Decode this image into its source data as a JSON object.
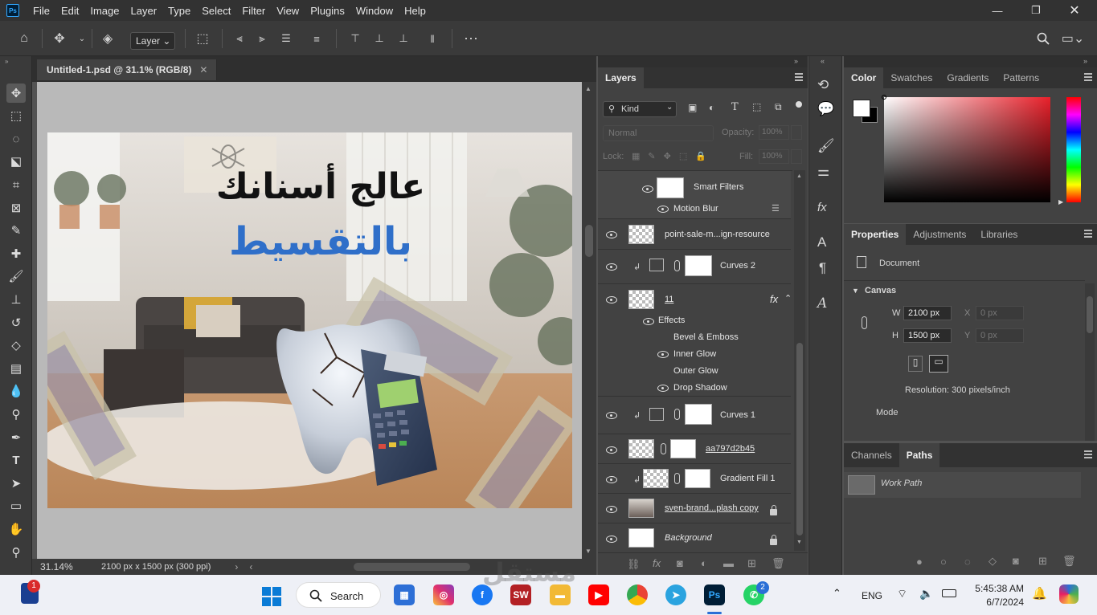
{
  "menu": [
    "File",
    "Edit",
    "Image",
    "Layer",
    "Type",
    "Select",
    "Filter",
    "View",
    "Plugins",
    "Window",
    "Help"
  ],
  "app_logo": "Ps",
  "options": {
    "auto_select_target": "Layer"
  },
  "document": {
    "tab_title": "Untitled-1.psd @ 31.1% (RGB/8)",
    "zoom": "31.14%",
    "dimensions": "2100 px x 1500 px (300 ppi)"
  },
  "artwork": {
    "headline_line1": "عالج أسنانك",
    "headline_line2": "بالتقسيط"
  },
  "layers_panel": {
    "tab": "Layers",
    "filter_kind": "Kind",
    "blend_mode": "Normal",
    "opacity_label": "Opacity:",
    "opacity": "100%",
    "lock_label": "Lock:",
    "fill_label": "Fill:",
    "fill": "100%",
    "smart_filters": "Smart Filters",
    "motion_blur": "Motion Blur",
    "layers": [
      {
        "name": "point-sale-m...ign-resource"
      },
      {
        "name": "Curves 2"
      },
      {
        "name": "11"
      },
      {
        "name": "Curves 1"
      },
      {
        "name": "aa797d2b45"
      },
      {
        "name": "Gradient Fill 1"
      },
      {
        "name": "sven-brand...plash copy"
      },
      {
        "name": "Background"
      }
    ],
    "effects_label": "Effects",
    "effects": [
      "Bevel & Emboss",
      "Inner Glow",
      "Outer Glow",
      "Drop Shadow"
    ]
  },
  "color_panel": {
    "tabs": [
      "Color",
      "Swatches",
      "Gradients",
      "Patterns"
    ]
  },
  "properties_panel": {
    "tabs": [
      "Properties",
      "Adjustments",
      "Libraries"
    ],
    "doc_label": "Document",
    "canvas_label": "Canvas",
    "w_label": "W",
    "w": "2100 px",
    "h_label": "H",
    "h": "1500 px",
    "x_label": "X",
    "x": "0 px",
    "y_label": "Y",
    "y": "0 px",
    "resolution": "Resolution: 300 pixels/inch",
    "mode_label": "Mode"
  },
  "paths_panel": {
    "tabs": [
      "Channels",
      "Paths"
    ],
    "work_path": "Work Path"
  },
  "taskbar": {
    "search": "Search",
    "lang": "ENG",
    "time": "5:45:38 AM",
    "date": "6/7/2024",
    "badge_left": "1",
    "badge_whatsapp": "2",
    "watermark": "مستقل"
  }
}
